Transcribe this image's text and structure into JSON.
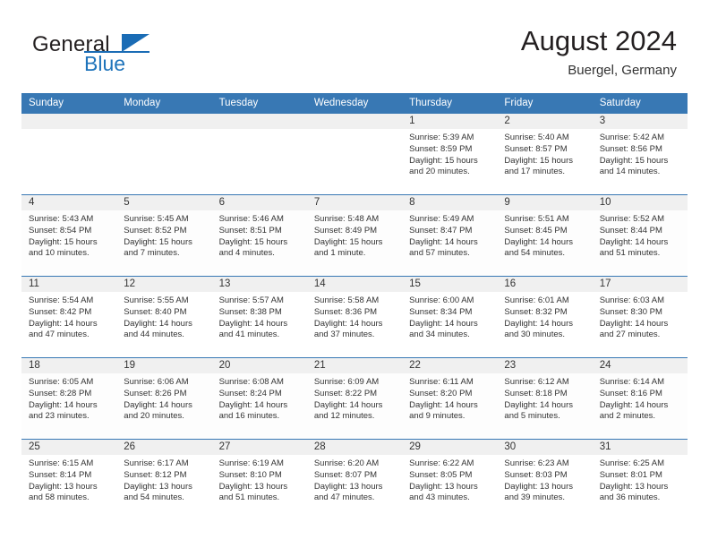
{
  "brand": {
    "name_part1": "General",
    "name_part2": "Blue",
    "logo_icon": "triangle-logo-icon"
  },
  "header": {
    "title": "August 2024",
    "subtitle": "Buergel, Germany"
  },
  "theme": {
    "header_blue": "#3878b4",
    "brand_blue": "#1a6cb5",
    "daynum_band": "#f0f0f0",
    "text": "#333333"
  },
  "weekday_headers": [
    "Sunday",
    "Monday",
    "Tuesday",
    "Wednesday",
    "Thursday",
    "Friday",
    "Saturday"
  ],
  "labels": {
    "sunrise_prefix": "Sunrise:",
    "sunset_prefix": "Sunset:",
    "daylight_prefix": "Daylight:"
  },
  "weeks": [
    [
      {
        "day": "",
        "line1": "",
        "line2": "",
        "line3": "",
        "line4": ""
      },
      {
        "day": "",
        "line1": "",
        "line2": "",
        "line3": "",
        "line4": ""
      },
      {
        "day": "",
        "line1": "",
        "line2": "",
        "line3": "",
        "line4": ""
      },
      {
        "day": "",
        "line1": "",
        "line2": "",
        "line3": "",
        "line4": ""
      },
      {
        "day": "1",
        "line1": "Sunrise: 5:39 AM",
        "line2": "Sunset: 8:59 PM",
        "line3": "Daylight: 15 hours",
        "line4": "and 20 minutes."
      },
      {
        "day": "2",
        "line1": "Sunrise: 5:40 AM",
        "line2": "Sunset: 8:57 PM",
        "line3": "Daylight: 15 hours",
        "line4": "and 17 minutes."
      },
      {
        "day": "3",
        "line1": "Sunrise: 5:42 AM",
        "line2": "Sunset: 8:56 PM",
        "line3": "Daylight: 15 hours",
        "line4": "and 14 minutes."
      }
    ],
    [
      {
        "day": "4",
        "line1": "Sunrise: 5:43 AM",
        "line2": "Sunset: 8:54 PM",
        "line3": "Daylight: 15 hours",
        "line4": "and 10 minutes."
      },
      {
        "day": "5",
        "line1": "Sunrise: 5:45 AM",
        "line2": "Sunset: 8:52 PM",
        "line3": "Daylight: 15 hours",
        "line4": "and 7 minutes."
      },
      {
        "day": "6",
        "line1": "Sunrise: 5:46 AM",
        "line2": "Sunset: 8:51 PM",
        "line3": "Daylight: 15 hours",
        "line4": "and 4 minutes."
      },
      {
        "day": "7",
        "line1": "Sunrise: 5:48 AM",
        "line2": "Sunset: 8:49 PM",
        "line3": "Daylight: 15 hours",
        "line4": "and 1 minute."
      },
      {
        "day": "8",
        "line1": "Sunrise: 5:49 AM",
        "line2": "Sunset: 8:47 PM",
        "line3": "Daylight: 14 hours",
        "line4": "and 57 minutes."
      },
      {
        "day": "9",
        "line1": "Sunrise: 5:51 AM",
        "line2": "Sunset: 8:45 PM",
        "line3": "Daylight: 14 hours",
        "line4": "and 54 minutes."
      },
      {
        "day": "10",
        "line1": "Sunrise: 5:52 AM",
        "line2": "Sunset: 8:44 PM",
        "line3": "Daylight: 14 hours",
        "line4": "and 51 minutes."
      }
    ],
    [
      {
        "day": "11",
        "line1": "Sunrise: 5:54 AM",
        "line2": "Sunset: 8:42 PM",
        "line3": "Daylight: 14 hours",
        "line4": "and 47 minutes."
      },
      {
        "day": "12",
        "line1": "Sunrise: 5:55 AM",
        "line2": "Sunset: 8:40 PM",
        "line3": "Daylight: 14 hours",
        "line4": "and 44 minutes."
      },
      {
        "day": "13",
        "line1": "Sunrise: 5:57 AM",
        "line2": "Sunset: 8:38 PM",
        "line3": "Daylight: 14 hours",
        "line4": "and 41 minutes."
      },
      {
        "day": "14",
        "line1": "Sunrise: 5:58 AM",
        "line2": "Sunset: 8:36 PM",
        "line3": "Daylight: 14 hours",
        "line4": "and 37 minutes."
      },
      {
        "day": "15",
        "line1": "Sunrise: 6:00 AM",
        "line2": "Sunset: 8:34 PM",
        "line3": "Daylight: 14 hours",
        "line4": "and 34 minutes."
      },
      {
        "day": "16",
        "line1": "Sunrise: 6:01 AM",
        "line2": "Sunset: 8:32 PM",
        "line3": "Daylight: 14 hours",
        "line4": "and 30 minutes."
      },
      {
        "day": "17",
        "line1": "Sunrise: 6:03 AM",
        "line2": "Sunset: 8:30 PM",
        "line3": "Daylight: 14 hours",
        "line4": "and 27 minutes."
      }
    ],
    [
      {
        "day": "18",
        "line1": "Sunrise: 6:05 AM",
        "line2": "Sunset: 8:28 PM",
        "line3": "Daylight: 14 hours",
        "line4": "and 23 minutes."
      },
      {
        "day": "19",
        "line1": "Sunrise: 6:06 AM",
        "line2": "Sunset: 8:26 PM",
        "line3": "Daylight: 14 hours",
        "line4": "and 20 minutes."
      },
      {
        "day": "20",
        "line1": "Sunrise: 6:08 AM",
        "line2": "Sunset: 8:24 PM",
        "line3": "Daylight: 14 hours",
        "line4": "and 16 minutes."
      },
      {
        "day": "21",
        "line1": "Sunrise: 6:09 AM",
        "line2": "Sunset: 8:22 PM",
        "line3": "Daylight: 14 hours",
        "line4": "and 12 minutes."
      },
      {
        "day": "22",
        "line1": "Sunrise: 6:11 AM",
        "line2": "Sunset: 8:20 PM",
        "line3": "Daylight: 14 hours",
        "line4": "and 9 minutes."
      },
      {
        "day": "23",
        "line1": "Sunrise: 6:12 AM",
        "line2": "Sunset: 8:18 PM",
        "line3": "Daylight: 14 hours",
        "line4": "and 5 minutes."
      },
      {
        "day": "24",
        "line1": "Sunrise: 6:14 AM",
        "line2": "Sunset: 8:16 PM",
        "line3": "Daylight: 14 hours",
        "line4": "and 2 minutes."
      }
    ],
    [
      {
        "day": "25",
        "line1": "Sunrise: 6:15 AM",
        "line2": "Sunset: 8:14 PM",
        "line3": "Daylight: 13 hours",
        "line4": "and 58 minutes."
      },
      {
        "day": "26",
        "line1": "Sunrise: 6:17 AM",
        "line2": "Sunset: 8:12 PM",
        "line3": "Daylight: 13 hours",
        "line4": "and 54 minutes."
      },
      {
        "day": "27",
        "line1": "Sunrise: 6:19 AM",
        "line2": "Sunset: 8:10 PM",
        "line3": "Daylight: 13 hours",
        "line4": "and 51 minutes."
      },
      {
        "day": "28",
        "line1": "Sunrise: 6:20 AM",
        "line2": "Sunset: 8:07 PM",
        "line3": "Daylight: 13 hours",
        "line4": "and 47 minutes."
      },
      {
        "day": "29",
        "line1": "Sunrise: 6:22 AM",
        "line2": "Sunset: 8:05 PM",
        "line3": "Daylight: 13 hours",
        "line4": "and 43 minutes."
      },
      {
        "day": "30",
        "line1": "Sunrise: 6:23 AM",
        "line2": "Sunset: 8:03 PM",
        "line3": "Daylight: 13 hours",
        "line4": "and 39 minutes."
      },
      {
        "day": "31",
        "line1": "Sunrise: 6:25 AM",
        "line2": "Sunset: 8:01 PM",
        "line3": "Daylight: 13 hours",
        "line4": "and 36 minutes."
      }
    ]
  ]
}
